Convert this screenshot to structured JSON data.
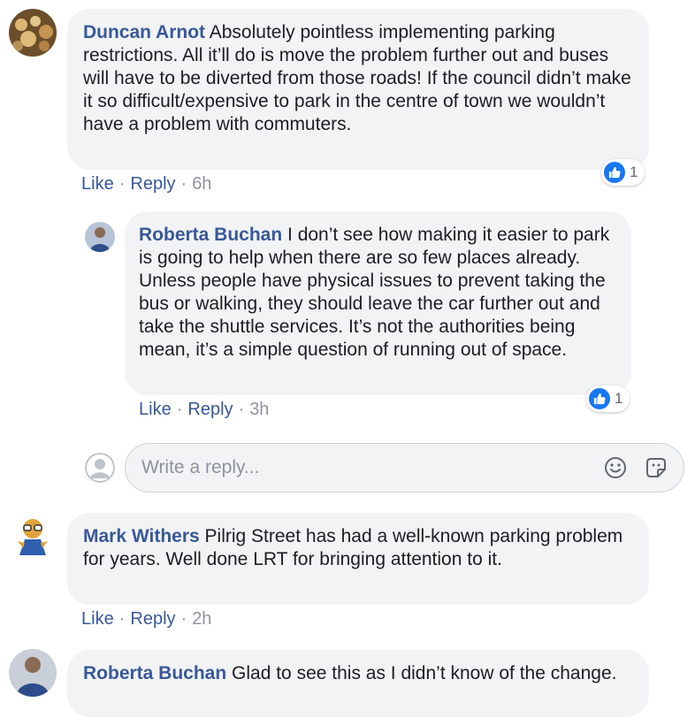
{
  "comments": [
    {
      "author": "Duncan Arnot",
      "text": "Absolutely pointless implementing parking restrictions. All it’ll do is move the problem further out and buses will have to be diverted from those roads! If the council didn’t make it so difficult/expensive to park in the centre of town we wouldn’t have a problem with commuters.",
      "like_label": "Like",
      "reply_label": "Reply",
      "time": "6h",
      "reaction_count": "1",
      "avatar_icon": "avatar-bokeh"
    },
    {
      "author": "Roberta Buchan",
      "text": "I don’t see how making it easier to park is going to help when there are so few places already. Unless people have physical issues to prevent taking the bus or walking, they should leave the car further out and take the shuttle services. It’s not the authorities being mean, it’s a simple question of running out of space.",
      "like_label": "Like",
      "reply_label": "Reply",
      "time": "3h",
      "reaction_count": "1",
      "avatar_icon": "avatar-person"
    },
    {
      "author": "Mark Withers",
      "text": "Pilrig Street has had a well-known parking problem for years. Well done LRT for bringing attention to it.",
      "like_label": "Like",
      "reply_label": "Reply",
      "time": "2h",
      "avatar_icon": "avatar-cartoon"
    },
    {
      "author": "Roberta Buchan",
      "text": "Glad to see this as I didn’t know of the change.",
      "avatar_icon": "avatar-person"
    }
  ],
  "reply_box": {
    "placeholder": "Write a reply...",
    "icons": [
      "smiley-icon",
      "sticker-icon"
    ]
  },
  "colors": {
    "author": "#385898",
    "bubble": "#f2f3f5",
    "meta": "#90949c",
    "like": "#1877f2"
  }
}
